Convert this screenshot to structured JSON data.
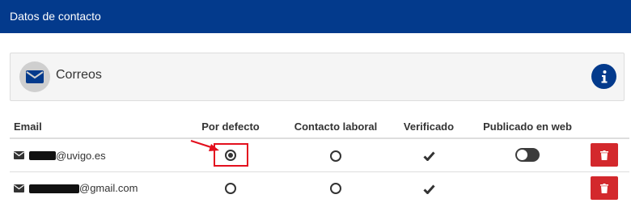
{
  "header": {
    "title": "Datos de contacto"
  },
  "panel": {
    "title": "Correos",
    "icon": "envelope-icon",
    "info_icon": "info-icon"
  },
  "table": {
    "columns": {
      "email": "Email",
      "default": "Por defecto",
      "work": "Contacto laboral",
      "verified": "Verificado",
      "published": "Publicado en web"
    },
    "rows": [
      {
        "email_domain": "@uvigo.es",
        "default": true,
        "work": false,
        "verified": true,
        "published": false
      },
      {
        "email_domain": "@gmail.com",
        "default": false,
        "work": false,
        "verified": true,
        "published": null
      }
    ]
  },
  "colors": {
    "header_bg": "#033a8c",
    "accent_red": "#d3282c",
    "highlight_red": "#e3101e"
  }
}
